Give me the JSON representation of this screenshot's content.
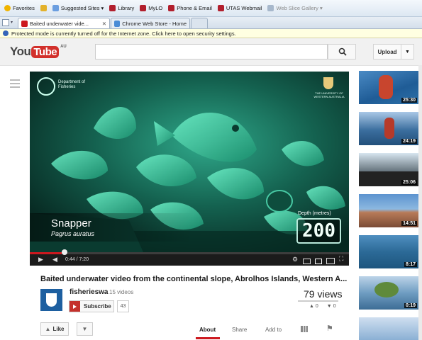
{
  "browser": {
    "favorites_bar": {
      "favorites": "Favorites",
      "items": [
        "Suggested Sites ▾",
        "Library",
        "MyLO",
        "Phone & Email",
        "UTAS Webmail",
        "Web Slice Gallery ▾"
      ]
    },
    "tabs": [
      {
        "label": "Baited underwater vide...",
        "active": true
      },
      {
        "label": "Chrome Web Store - Home",
        "active": false
      }
    ],
    "info_bar": "Protected mode is currently turned off for the Internet zone. Click here to open security settings."
  },
  "youtube": {
    "logo": {
      "you": "You",
      "tube": "Tube",
      "region": "AU"
    },
    "search": {
      "placeholder": ""
    },
    "upload_label": "Upload",
    "colors": {
      "brand_red": "#cc181e",
      "overlay_green": "#27c9a0"
    }
  },
  "player": {
    "watermark_left": "Department of Fisheries",
    "watermark_right": "THE UNIVERSITY OF WESTERN AUSTRALIA",
    "species_common": "Snapper",
    "species_latin": "Pagrus auratus",
    "depth_label": "Depth (metres)",
    "depth_value": "200",
    "time_current": "0:44",
    "time_total": "7:20",
    "progress_fraction": 0.1
  },
  "video_info": {
    "title": "Baited underwater video from the continental slope, Abrolhos Islands, Western A...",
    "channel": "fisherieswa",
    "video_count": "15 videos",
    "subscribe_label": "Subscribe",
    "subscriber_count": "43",
    "views": "79 views",
    "likes": "0",
    "dislikes": "0",
    "like_label": "Like",
    "action_tabs": [
      "About",
      "Share",
      "Add to"
    ]
  },
  "sidebar": {
    "thumbnails": [
      {
        "duration": "25:30"
      },
      {
        "duration": "24:19"
      },
      {
        "duration": "25:06"
      },
      {
        "duration": "14:51"
      },
      {
        "duration": "8:17"
      },
      {
        "duration": "0:19"
      },
      {
        "duration": ""
      }
    ]
  }
}
